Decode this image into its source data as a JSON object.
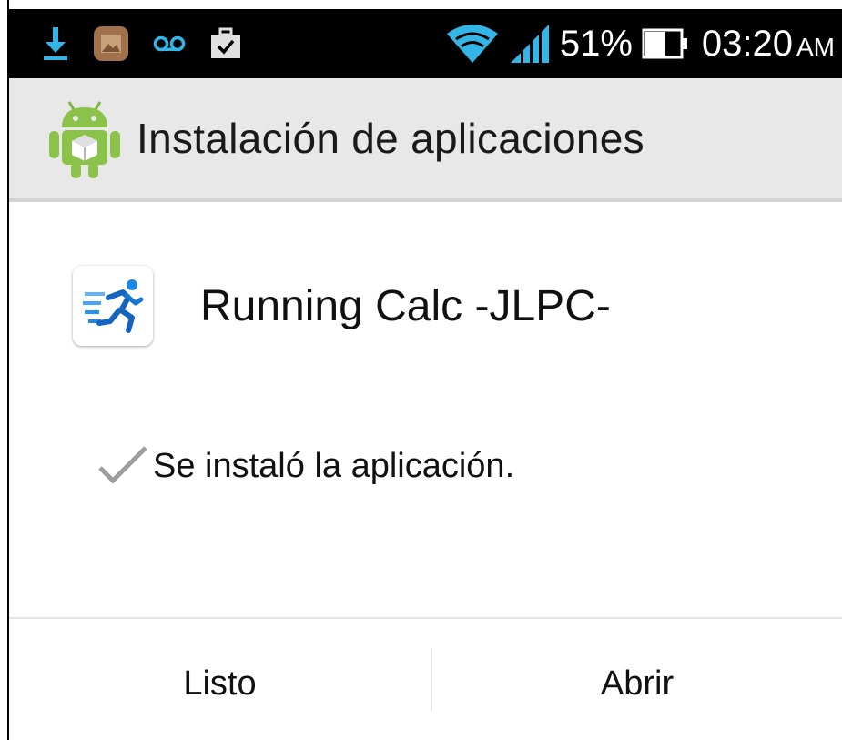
{
  "status_bar": {
    "battery_percent": "51%",
    "time": "03:20",
    "ampm": "AM",
    "icons": [
      "download-icon",
      "gallery-icon",
      "voicemail-icon",
      "briefcase-icon",
      "wifi-icon",
      "signal-icon",
      "battery-icon"
    ],
    "accent_color": "#33b5e5"
  },
  "action_bar": {
    "title": "Instalación de aplicaciones",
    "icon": "android-installer-icon"
  },
  "app": {
    "name": "Running Calc -JLPC-",
    "icon": "running-person-icon"
  },
  "status": {
    "message": "Se instaló la aplicación.",
    "icon": "checkmark-icon"
  },
  "buttons": {
    "done_label": "Listo",
    "open_label": "Abrir"
  }
}
